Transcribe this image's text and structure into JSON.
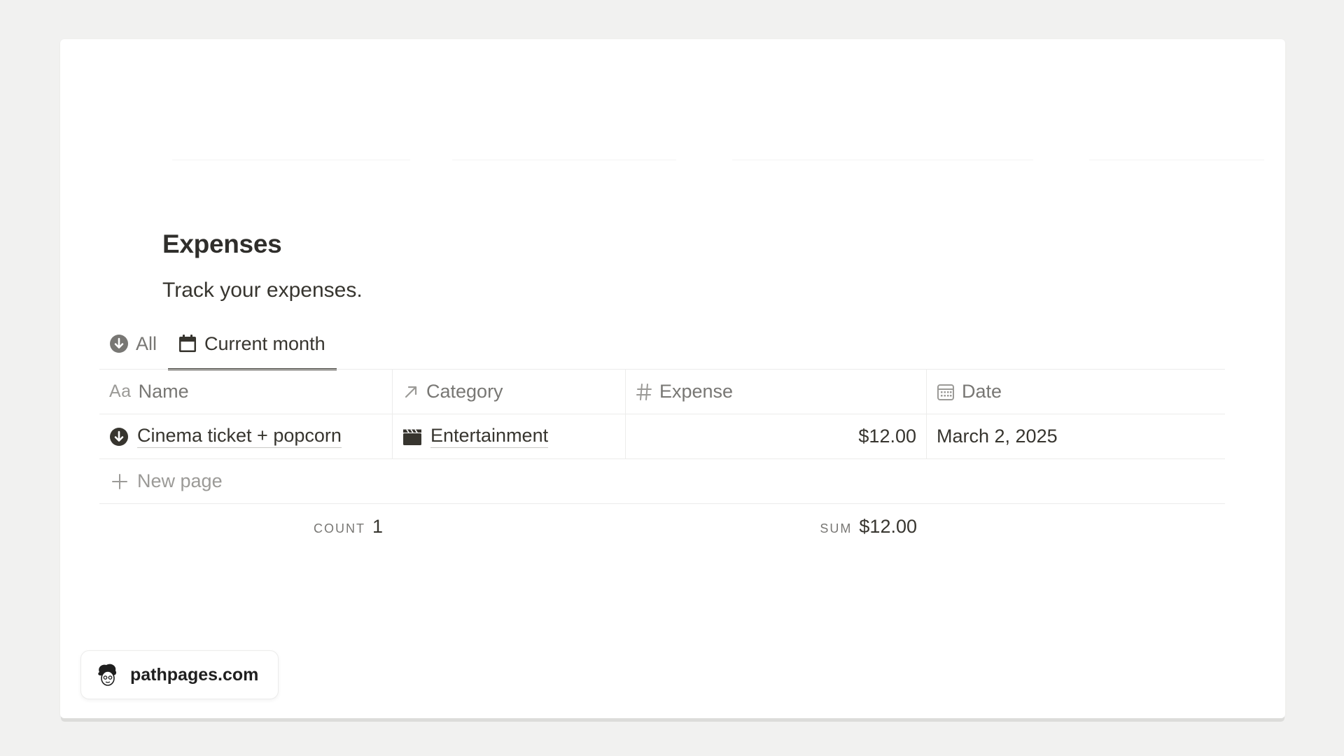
{
  "database": {
    "title": "Expenses",
    "description": "Track your expenses."
  },
  "views": [
    {
      "label": "All",
      "icon": "arrow-down-circle-icon",
      "active": false
    },
    {
      "label": "Current month",
      "icon": "calendar-icon",
      "active": true
    }
  ],
  "columns": [
    {
      "label": "Name",
      "icon": "text-aa-icon"
    },
    {
      "label": "Category",
      "icon": "relation-arrow-icon"
    },
    {
      "label": "Expense",
      "icon": "hash-icon"
    },
    {
      "label": "Date",
      "icon": "calendar-grid-icon"
    }
  ],
  "rows": [
    {
      "name": "Cinema ticket + popcorn",
      "name_icon": "arrow-down-circle-icon",
      "category": "Entertainment",
      "category_icon": "clapperboard-icon",
      "expense": "$12.00",
      "date": "March 2, 2025"
    }
  ],
  "new_page_label": "New page",
  "footer": {
    "count_label": "COUNT",
    "count_value": "1",
    "sum_label": "SUM",
    "sum_value": "$12.00"
  },
  "badge": {
    "label": "pathpages.com",
    "icon": "avatar-logo-icon"
  },
  "colors": {
    "text": "#37352f",
    "muted": "#787774",
    "border": "#ececeb",
    "background": "#f1f1f0"
  }
}
